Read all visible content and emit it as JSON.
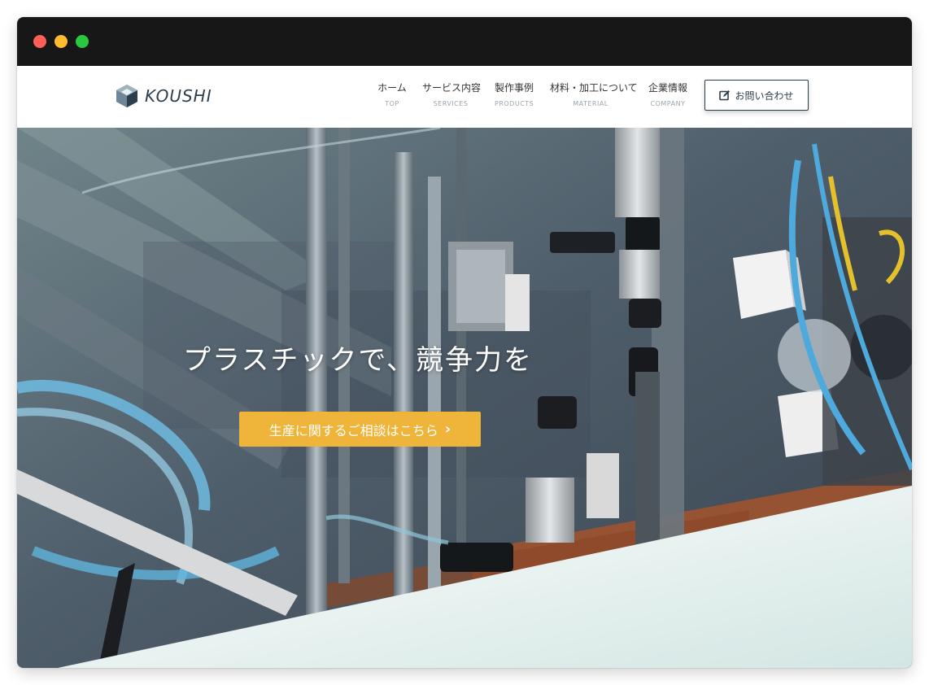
{
  "brand": {
    "name": "KOUSHI",
    "logo_icon": "hexagon-cube-icon",
    "text_color": "#2d3e4b"
  },
  "nav": {
    "items": [
      {
        "label": "ホーム",
        "sub": "TOP"
      },
      {
        "label": "サービス内容",
        "sub": "SERVICES"
      },
      {
        "label": "製作事例",
        "sub": "PRODUCTS"
      },
      {
        "label": "材料・加工について",
        "sub": "MATERIAL"
      },
      {
        "label": "企業情報",
        "sub": "COMPANY"
      }
    ],
    "contact_label": "お問い合わせ",
    "contact_icon": "edit-icon"
  },
  "hero": {
    "title": "プラスチックで、競争力を",
    "cta_label": "生産に関するご相談はこちら",
    "cta_icon": "chevron-right-icon",
    "cta_color": "#efb43a",
    "background_image": "industrial-machinery-photo"
  },
  "window": {
    "controls": [
      "close",
      "minimize",
      "maximize"
    ]
  }
}
